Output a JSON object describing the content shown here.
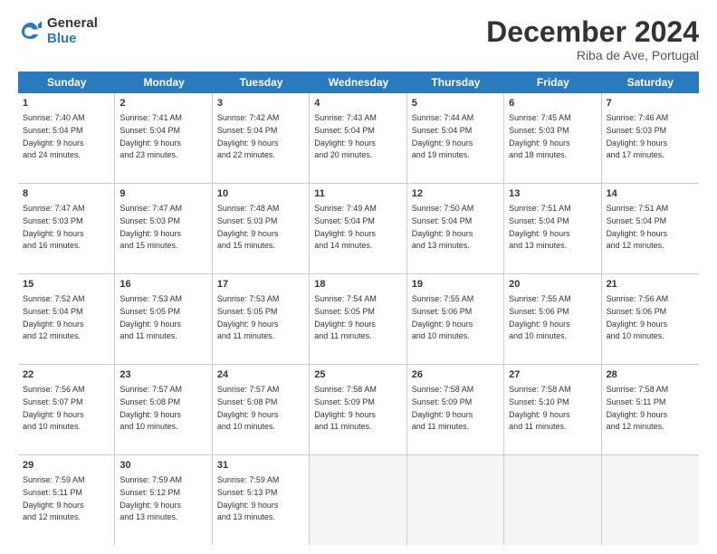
{
  "logo": {
    "general": "General",
    "blue": "Blue"
  },
  "header": {
    "month": "December 2024",
    "location": "Riba de Ave, Portugal"
  },
  "days": [
    "Sunday",
    "Monday",
    "Tuesday",
    "Wednesday",
    "Thursday",
    "Friday",
    "Saturday"
  ],
  "weeks": [
    [
      {
        "day": "1",
        "lines": [
          "Sunrise: 7:40 AM",
          "Sunset: 5:04 PM",
          "Daylight: 9 hours",
          "and 24 minutes."
        ]
      },
      {
        "day": "2",
        "lines": [
          "Sunrise: 7:41 AM",
          "Sunset: 5:04 PM",
          "Daylight: 9 hours",
          "and 23 minutes."
        ]
      },
      {
        "day": "3",
        "lines": [
          "Sunrise: 7:42 AM",
          "Sunset: 5:04 PM",
          "Daylight: 9 hours",
          "and 22 minutes."
        ]
      },
      {
        "day": "4",
        "lines": [
          "Sunrise: 7:43 AM",
          "Sunset: 5:04 PM",
          "Daylight: 9 hours",
          "and 20 minutes."
        ]
      },
      {
        "day": "5",
        "lines": [
          "Sunrise: 7:44 AM",
          "Sunset: 5:04 PM",
          "Daylight: 9 hours",
          "and 19 minutes."
        ]
      },
      {
        "day": "6",
        "lines": [
          "Sunrise: 7:45 AM",
          "Sunset: 5:03 PM",
          "Daylight: 9 hours",
          "and 18 minutes."
        ]
      },
      {
        "day": "7",
        "lines": [
          "Sunrise: 7:46 AM",
          "Sunset: 5:03 PM",
          "Daylight: 9 hours",
          "and 17 minutes."
        ]
      }
    ],
    [
      {
        "day": "8",
        "lines": [
          "Sunrise: 7:47 AM",
          "Sunset: 5:03 PM",
          "Daylight: 9 hours",
          "and 16 minutes."
        ]
      },
      {
        "day": "9",
        "lines": [
          "Sunrise: 7:47 AM",
          "Sunset: 5:03 PM",
          "Daylight: 9 hours",
          "and 15 minutes."
        ]
      },
      {
        "day": "10",
        "lines": [
          "Sunrise: 7:48 AM",
          "Sunset: 5:03 PM",
          "Daylight: 9 hours",
          "and 15 minutes."
        ]
      },
      {
        "day": "11",
        "lines": [
          "Sunrise: 7:49 AM",
          "Sunset: 5:04 PM",
          "Daylight: 9 hours",
          "and 14 minutes."
        ]
      },
      {
        "day": "12",
        "lines": [
          "Sunrise: 7:50 AM",
          "Sunset: 5:04 PM",
          "Daylight: 9 hours",
          "and 13 minutes."
        ]
      },
      {
        "day": "13",
        "lines": [
          "Sunrise: 7:51 AM",
          "Sunset: 5:04 PM",
          "Daylight: 9 hours",
          "and 13 minutes."
        ]
      },
      {
        "day": "14",
        "lines": [
          "Sunrise: 7:51 AM",
          "Sunset: 5:04 PM",
          "Daylight: 9 hours",
          "and 12 minutes."
        ]
      }
    ],
    [
      {
        "day": "15",
        "lines": [
          "Sunrise: 7:52 AM",
          "Sunset: 5:04 PM",
          "Daylight: 9 hours",
          "and 12 minutes."
        ]
      },
      {
        "day": "16",
        "lines": [
          "Sunrise: 7:53 AM",
          "Sunset: 5:05 PM",
          "Daylight: 9 hours",
          "and 11 minutes."
        ]
      },
      {
        "day": "17",
        "lines": [
          "Sunrise: 7:53 AM",
          "Sunset: 5:05 PM",
          "Daylight: 9 hours",
          "and 11 minutes."
        ]
      },
      {
        "day": "18",
        "lines": [
          "Sunrise: 7:54 AM",
          "Sunset: 5:05 PM",
          "Daylight: 9 hours",
          "and 11 minutes."
        ]
      },
      {
        "day": "19",
        "lines": [
          "Sunrise: 7:55 AM",
          "Sunset: 5:06 PM",
          "Daylight: 9 hours",
          "and 10 minutes."
        ]
      },
      {
        "day": "20",
        "lines": [
          "Sunrise: 7:55 AM",
          "Sunset: 5:06 PM",
          "Daylight: 9 hours",
          "and 10 minutes."
        ]
      },
      {
        "day": "21",
        "lines": [
          "Sunrise: 7:56 AM",
          "Sunset: 5:06 PM",
          "Daylight: 9 hours",
          "and 10 minutes."
        ]
      }
    ],
    [
      {
        "day": "22",
        "lines": [
          "Sunrise: 7:56 AM",
          "Sunset: 5:07 PM",
          "Daylight: 9 hours",
          "and 10 minutes."
        ]
      },
      {
        "day": "23",
        "lines": [
          "Sunrise: 7:57 AM",
          "Sunset: 5:08 PM",
          "Daylight: 9 hours",
          "and 10 minutes."
        ]
      },
      {
        "day": "24",
        "lines": [
          "Sunrise: 7:57 AM",
          "Sunset: 5:08 PM",
          "Daylight: 9 hours",
          "and 10 minutes."
        ]
      },
      {
        "day": "25",
        "lines": [
          "Sunrise: 7:58 AM",
          "Sunset: 5:09 PM",
          "Daylight: 9 hours",
          "and 11 minutes."
        ]
      },
      {
        "day": "26",
        "lines": [
          "Sunrise: 7:58 AM",
          "Sunset: 5:09 PM",
          "Daylight: 9 hours",
          "and 11 minutes."
        ]
      },
      {
        "day": "27",
        "lines": [
          "Sunrise: 7:58 AM",
          "Sunset: 5:10 PM",
          "Daylight: 9 hours",
          "and 11 minutes."
        ]
      },
      {
        "day": "28",
        "lines": [
          "Sunrise: 7:58 AM",
          "Sunset: 5:11 PM",
          "Daylight: 9 hours",
          "and 12 minutes."
        ]
      }
    ],
    [
      {
        "day": "29",
        "lines": [
          "Sunrise: 7:59 AM",
          "Sunset: 5:11 PM",
          "Daylight: 9 hours",
          "and 12 minutes."
        ]
      },
      {
        "day": "30",
        "lines": [
          "Sunrise: 7:59 AM",
          "Sunset: 5:12 PM",
          "Daylight: 9 hours",
          "and 13 minutes."
        ]
      },
      {
        "day": "31",
        "lines": [
          "Sunrise: 7:59 AM",
          "Sunset: 5:13 PM",
          "Daylight: 9 hours",
          "and 13 minutes."
        ]
      },
      null,
      null,
      null,
      null
    ]
  ]
}
